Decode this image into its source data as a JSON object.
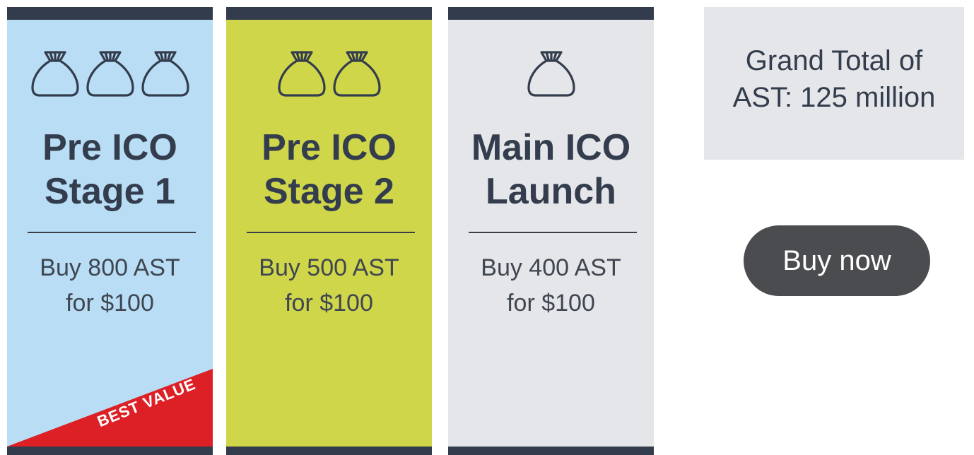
{
  "stages": [
    {
      "title": "Pre ICO\nStage 1",
      "price": "Buy 800 AST\nfor $100",
      "bag_count": 3,
      "color": "#b8ddf5",
      "badge": "BEST VALUE"
    },
    {
      "title": "Pre ICO\nStage 2",
      "price": "Buy 500 AST\nfor $100",
      "bag_count": 2,
      "color": "#d0d64a"
    },
    {
      "title": "Main ICO\nLaunch",
      "price": "Buy 400 AST\nfor $100",
      "bag_count": 1,
      "color": "#e5e6e9"
    }
  ],
  "summary": {
    "grand_total": "Grand Total of\nAST: 125 million"
  },
  "cta": {
    "label": "Buy now"
  },
  "colors": {
    "header_bar": "#323c4c",
    "badge": "#dc2026",
    "button": "#4b4c4f",
    "text_dark": "#333d4d"
  },
  "icons": {
    "bag": "money-bag-icon"
  }
}
